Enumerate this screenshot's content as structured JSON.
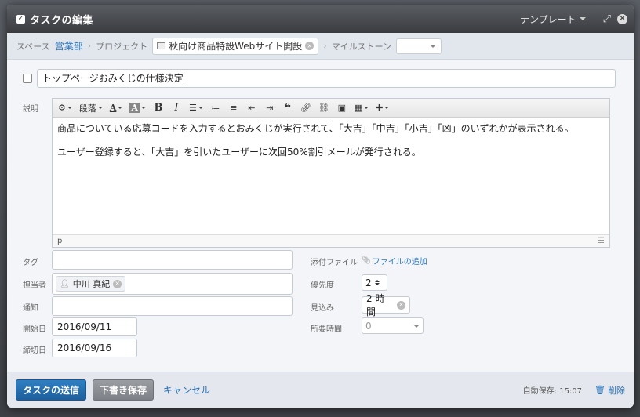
{
  "dialog": {
    "title": "タスクの編集",
    "template_label": "テンプレート"
  },
  "breadcrumb": {
    "space_label": "スペース",
    "space_value": "営業部",
    "project_label": "プロジェクト",
    "project_value": "秋向け商品特設Webサイト開設",
    "milestone_label": "マイルストーン",
    "milestone_value": ""
  },
  "task": {
    "subject": "トップページおみくじの仕様決定"
  },
  "description": {
    "label": "説明",
    "toolbar": {
      "paragraph_label": "段落"
    },
    "lines": [
      "商品についている応募コードを入力するとおみくじが実行されて、「大吉」「中吉」「小吉」「凶」のいずれかが表示される。",
      "ユーザー登録すると、「大吉」を引いたユーザーに次回50%割引メールが発行される。"
    ],
    "path_indicator": "p"
  },
  "fields": {
    "tag_label": "タグ",
    "tag_value": "",
    "assignee_label": "担当者",
    "assignee_value": "中川 真紀",
    "notify_label": "通知",
    "notify_value": "",
    "start_label": "開始日",
    "start_value": "2016/09/11",
    "due_label": "締切日",
    "due_value": "2016/09/16",
    "attachment_label": "添付ファイル",
    "attachment_link": "ファイルの追加",
    "priority_label": "優先度",
    "priority_value": "2",
    "estimate_label": "見込み",
    "estimate_value": "2 時間",
    "actual_label": "所要時間",
    "actual_value": "0"
  },
  "footer": {
    "submit_label": "タスクの送信",
    "draft_label": "下書き保存",
    "cancel_label": "キャンセル",
    "autosave_text": "自動保存: 15:07",
    "delete_label": "削除"
  }
}
